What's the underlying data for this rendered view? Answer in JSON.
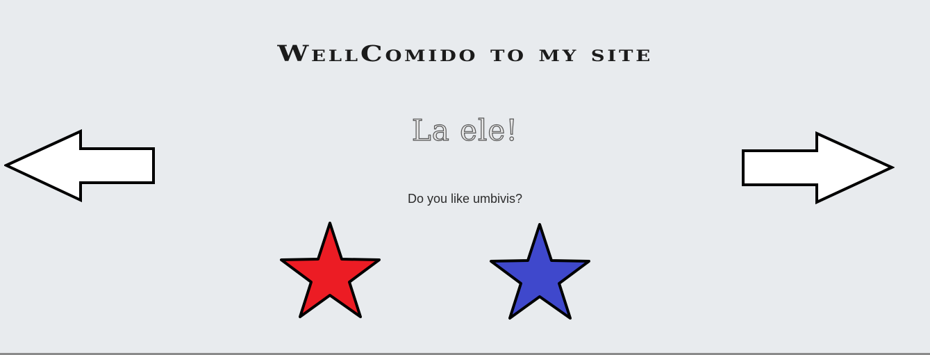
{
  "header": {
    "title": "WellComido to my site"
  },
  "main": {
    "greeting": "La ele!",
    "question": "Do you like umbivis?"
  },
  "navigation": {
    "prev_icon": "left-arrow-icon",
    "next_icon": "right-arrow-icon"
  },
  "rating": {
    "options": [
      {
        "icon": "star-icon",
        "color": "#ec1c24"
      },
      {
        "icon": "star-icon",
        "color": "#3f48cc"
      }
    ]
  },
  "colors": {
    "background": "#e8ebee",
    "outline": "#000000"
  }
}
